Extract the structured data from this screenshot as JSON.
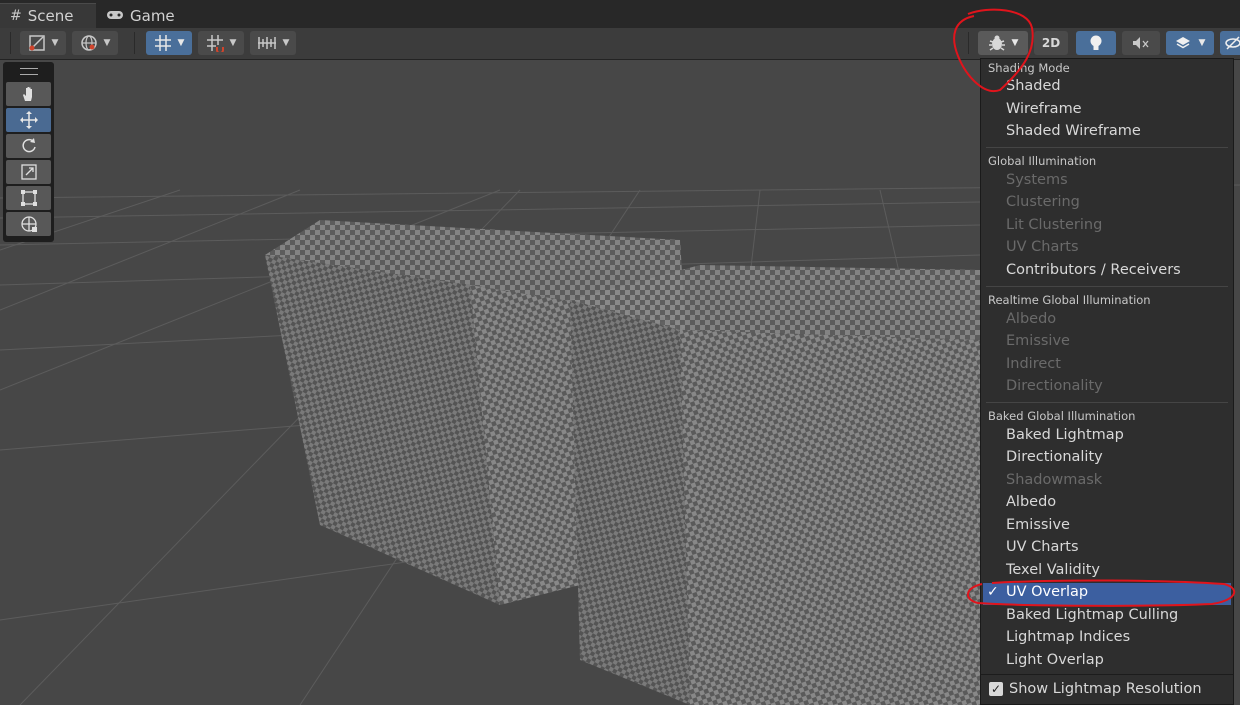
{
  "tabs": [
    {
      "label": "Scene",
      "icon": "grid-hash-icon"
    },
    {
      "label": "Game",
      "icon": "gamepad-icon"
    }
  ],
  "toolbar": {
    "mode_2d_label": "2D"
  },
  "shading_menu": {
    "sections": [
      {
        "header": "Shading Mode",
        "items": [
          {
            "label": "Shaded",
            "enabled": true
          },
          {
            "label": "Wireframe",
            "enabled": true
          },
          {
            "label": "Shaded Wireframe",
            "enabled": true
          }
        ]
      },
      {
        "header": "Global Illumination",
        "items": [
          {
            "label": "Systems",
            "enabled": false
          },
          {
            "label": "Clustering",
            "enabled": false
          },
          {
            "label": "Lit Clustering",
            "enabled": false
          },
          {
            "label": "UV Charts",
            "enabled": false
          },
          {
            "label": "Contributors / Receivers",
            "enabled": true
          }
        ]
      },
      {
        "header": "Realtime Global Illumination",
        "items": [
          {
            "label": "Albedo",
            "enabled": false
          },
          {
            "label": "Emissive",
            "enabled": false
          },
          {
            "label": "Indirect",
            "enabled": false
          },
          {
            "label": "Directionality",
            "enabled": false
          }
        ]
      },
      {
        "header": "Baked Global Illumination",
        "items": [
          {
            "label": "Baked Lightmap",
            "enabled": true
          },
          {
            "label": "Directionality",
            "enabled": true
          },
          {
            "label": "Shadowmask",
            "enabled": false
          },
          {
            "label": "Albedo",
            "enabled": true
          },
          {
            "label": "Emissive",
            "enabled": true
          },
          {
            "label": "UV Charts",
            "enabled": true
          },
          {
            "label": "Texel Validity",
            "enabled": true
          },
          {
            "label": "UV Overlap",
            "enabled": true,
            "selected": true
          },
          {
            "label": "Baked Lightmap Culling",
            "enabled": true
          },
          {
            "label": "Lightmap Indices",
            "enabled": true
          },
          {
            "label": "Light Overlap",
            "enabled": true
          }
        ]
      }
    ],
    "show_lightmap_resolution": {
      "label": "Show Lightmap Resolution",
      "checked": true
    }
  },
  "colors": {
    "menu_bg": "#2e2e2e",
    "selection": "#3c5fa0",
    "annotation_red": "#e0141c",
    "viewport_bg": "#474747"
  }
}
